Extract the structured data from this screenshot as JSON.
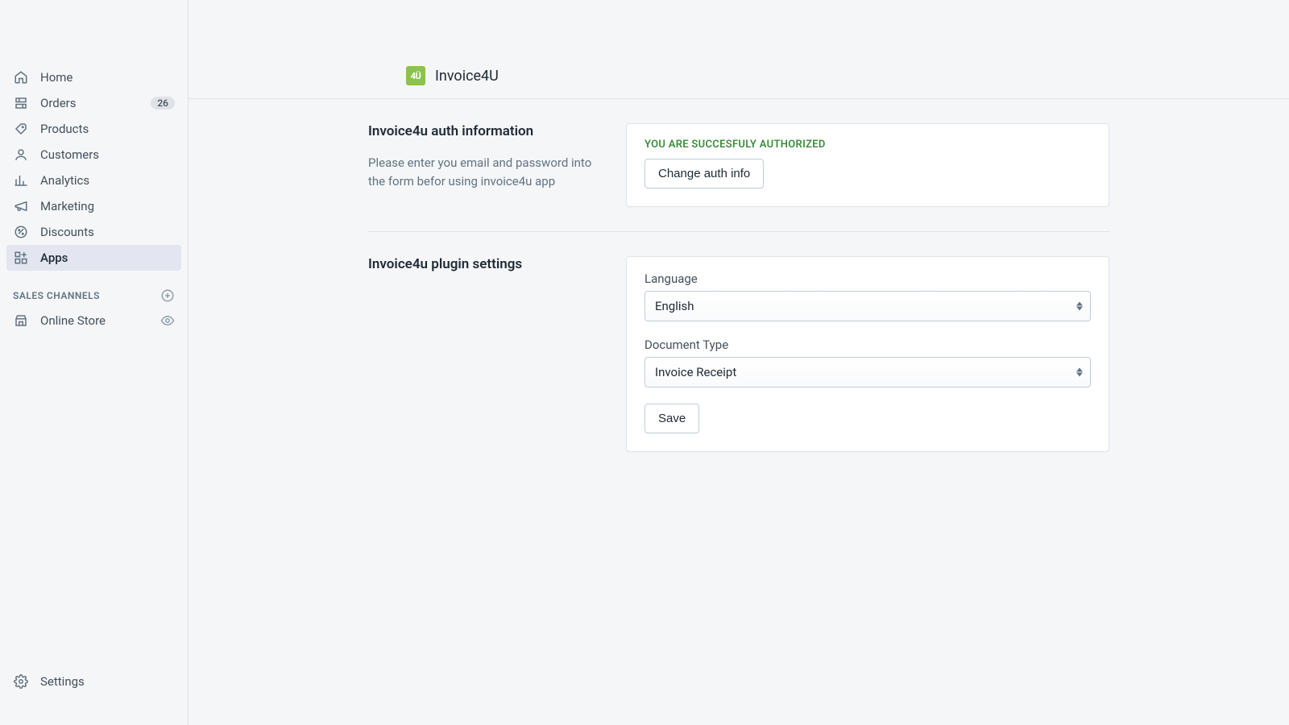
{
  "sidebar": {
    "items": [
      {
        "label": "Home",
        "icon": "home"
      },
      {
        "label": "Orders",
        "icon": "orders",
        "badge": "26"
      },
      {
        "label": "Products",
        "icon": "products"
      },
      {
        "label": "Customers",
        "icon": "customers"
      },
      {
        "label": "Analytics",
        "icon": "analytics"
      },
      {
        "label": "Marketing",
        "icon": "marketing"
      },
      {
        "label": "Discounts",
        "icon": "discounts"
      },
      {
        "label": "Apps",
        "icon": "apps",
        "active": true
      }
    ],
    "channels_header": "SALES CHANNELS",
    "channels": [
      {
        "label": "Online Store",
        "icon": "store"
      }
    ],
    "settings_label": "Settings"
  },
  "header": {
    "logo_text": "4Ü",
    "title": "Invoice4U"
  },
  "auth": {
    "heading": "Invoice4u auth information",
    "description": "Please enter you email and password into the form befor using invoice4u app",
    "status": "YOU ARE SUCCESFULY AUTHORIZED",
    "button": "Change auth info"
  },
  "settings": {
    "heading": "Invoice4u plugin settings",
    "language_label": "Language",
    "language_value": "English",
    "doctype_label": "Document Type",
    "doctype_value": "Invoice Receipt",
    "save": "Save"
  }
}
